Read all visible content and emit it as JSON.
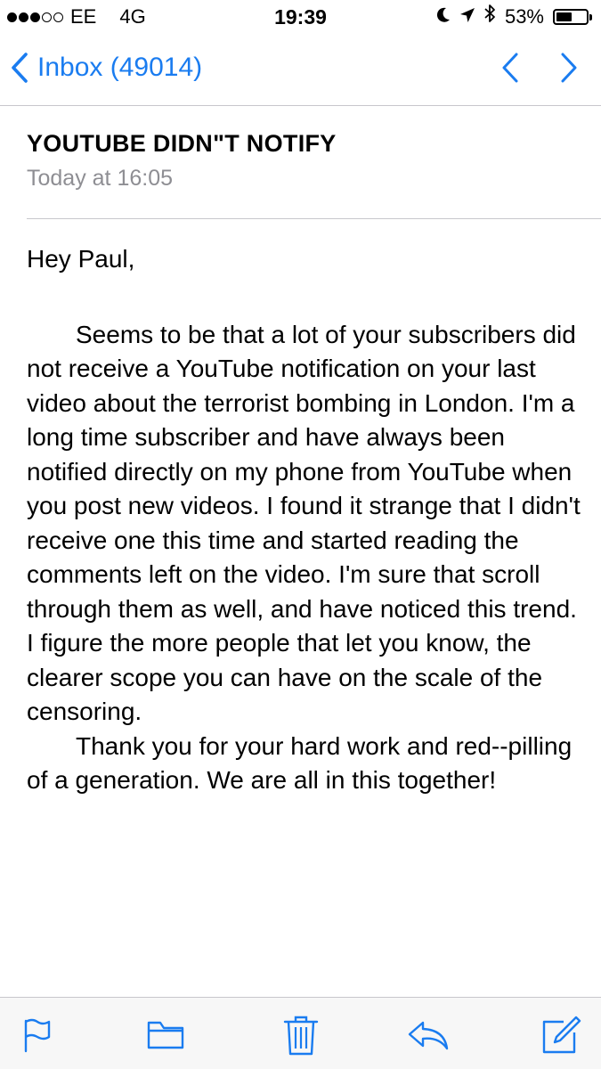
{
  "status_bar": {
    "carrier": "EE",
    "network": "4G",
    "time": "19:39",
    "battery_text": "53%",
    "battery_level": 0.53,
    "signal_bars_full": 3,
    "signal_bars_total": 5,
    "icons": [
      "moon-icon",
      "location-arrow-icon",
      "bluetooth-icon",
      "battery-icon"
    ]
  },
  "nav": {
    "back_label": "Inbox (49014)",
    "accent_color": "#1a7cf0"
  },
  "email": {
    "subject": "YOUTUBE DIDN\"T NOTIFY",
    "date": "Today at 16:05",
    "greeting": "Hey Paul,",
    "paragraph_1": "Seems to be that  a lot of your subscribers did not receive a YouTube notification on your last video about the terrorist bombing in London.   I'm a  long time subscriber and have always been notified directly on my phone from YouTube when you post new videos.  I found it strange that I didn't receive one this time and started reading the comments left on the video.  I'm sure that scroll through them as well, and have noticed this trend.  I figure the more people that let you know, the clearer scope you can have on the scale of the censoring.",
    "paragraph_2": "Thank you for your hard work and red--pilling of a generation.  We are all in this together!"
  },
  "toolbar": {
    "icons": [
      "flag-icon",
      "folder-icon",
      "trash-icon",
      "reply-icon",
      "compose-icon"
    ]
  }
}
